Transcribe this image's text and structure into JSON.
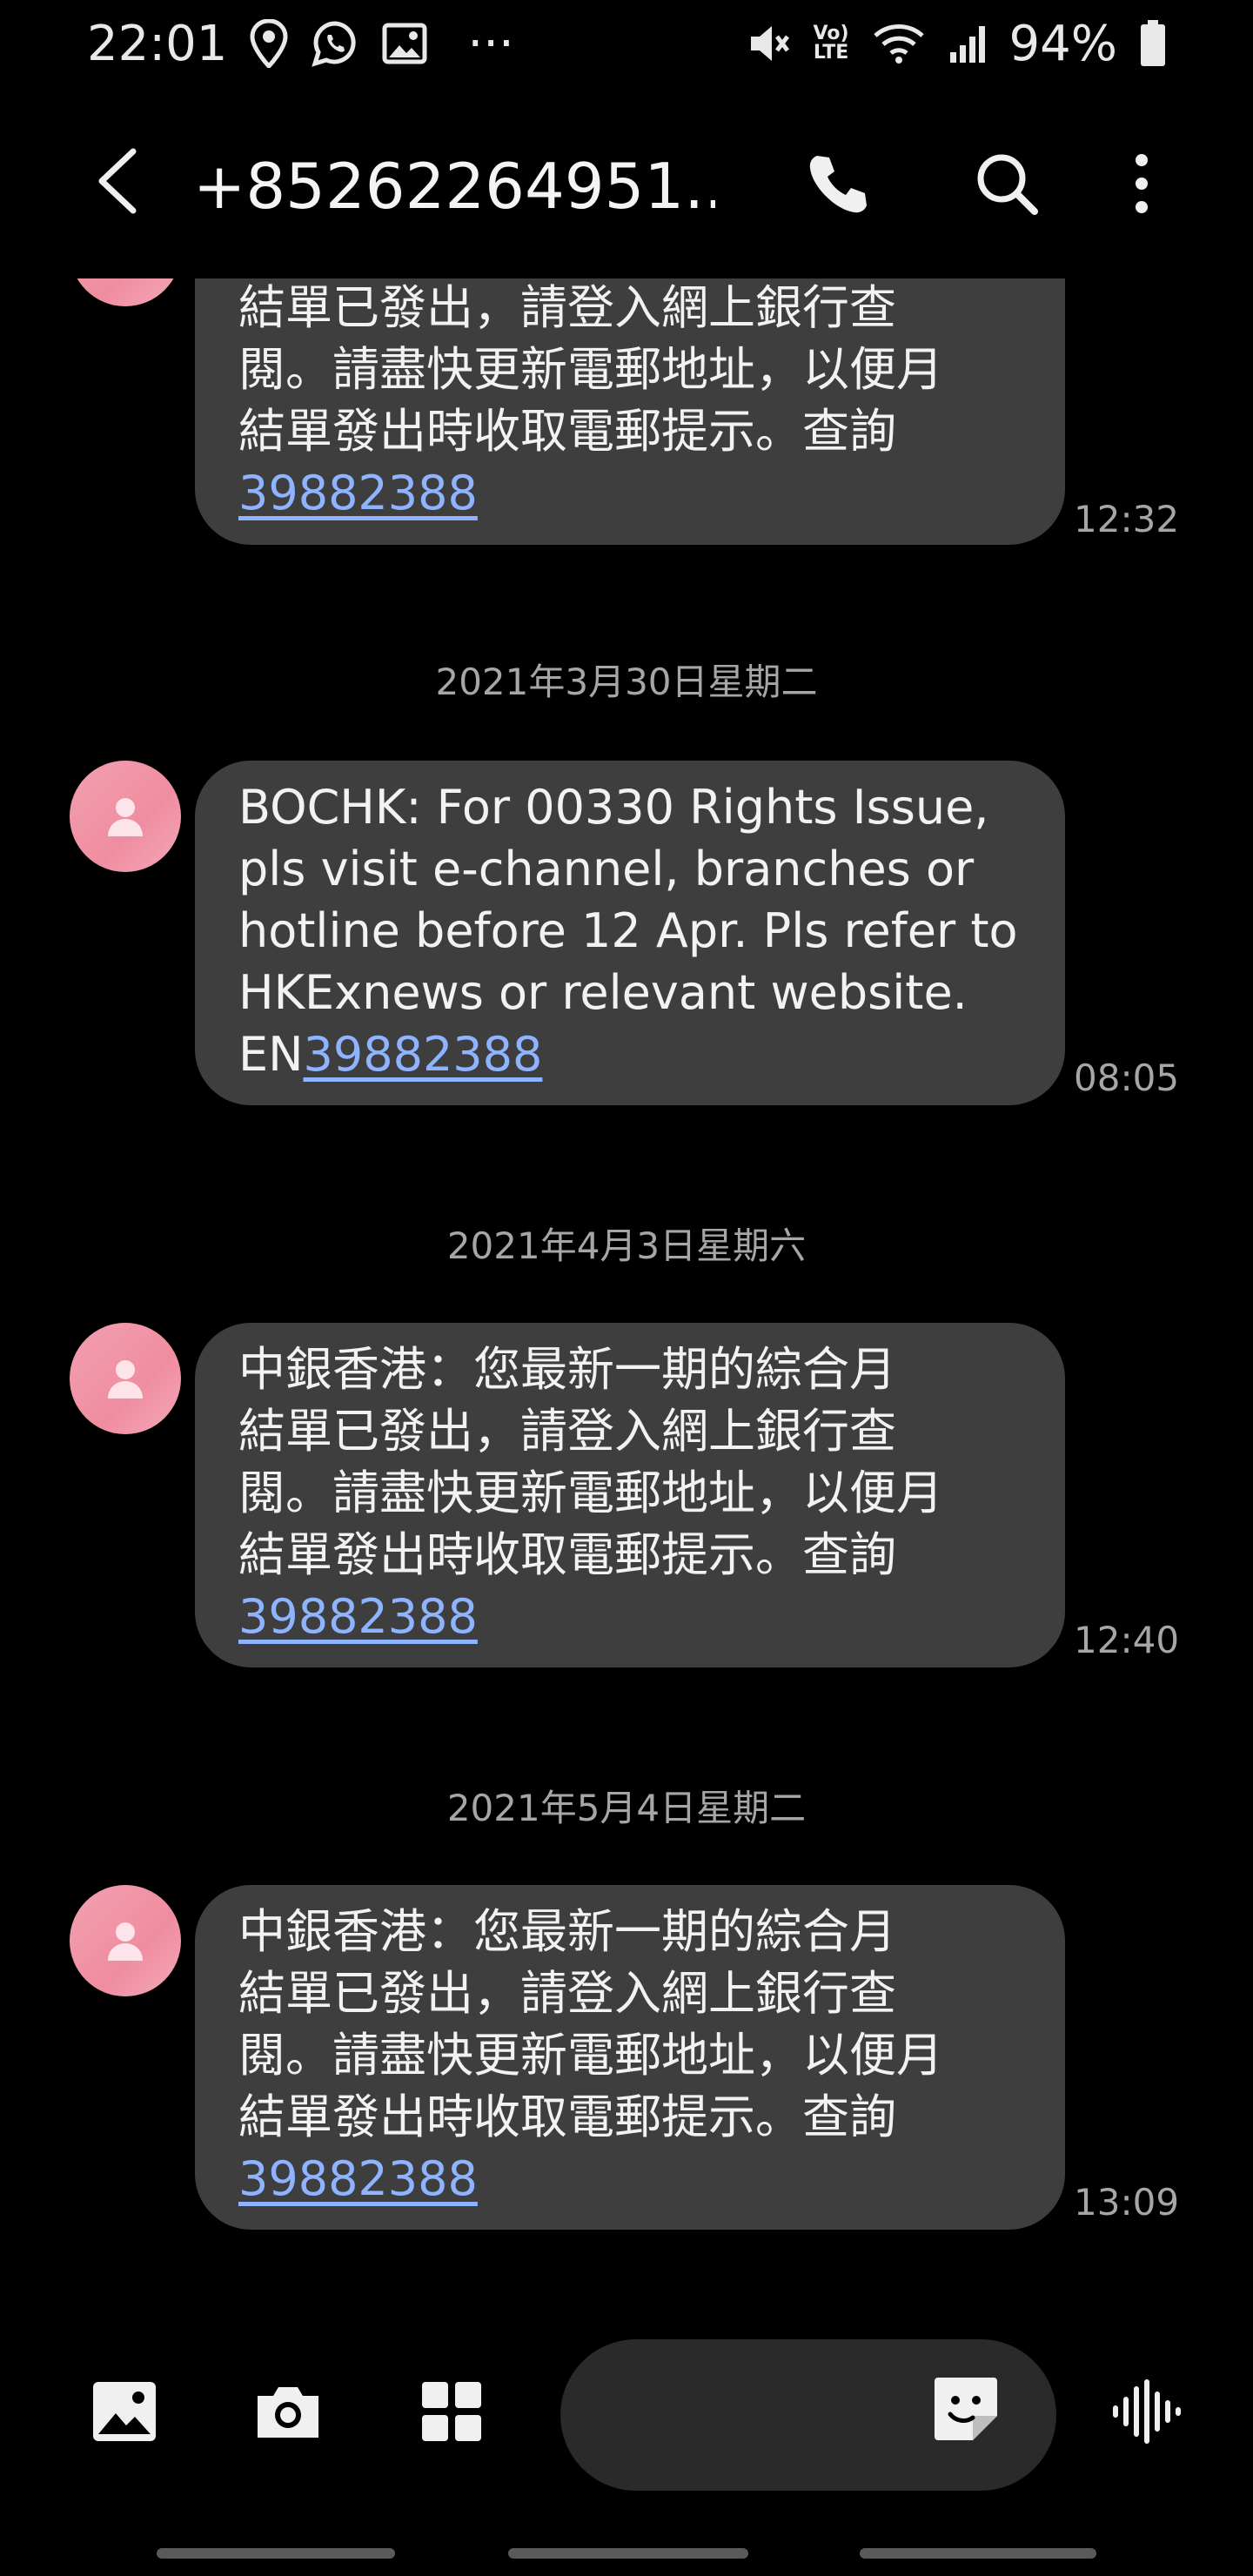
{
  "status_bar": {
    "time": "22:01",
    "more_indicator": "···",
    "battery": "94%",
    "lte_label_top": "Vo)",
    "lte_label_bottom": "LTE",
    "icons": [
      "location-pin-icon",
      "whatsapp-icon",
      "gallery-icon",
      "mute-icon",
      "volte-icon",
      "wifi-icon",
      "signal-icon",
      "battery-icon"
    ]
  },
  "app_bar": {
    "contact": "+85262264951...",
    "icons": [
      "back-arrow-icon",
      "phone-icon",
      "search-icon",
      "more-vert-icon"
    ]
  },
  "messages": [
    {
      "lines": [
        "結單已發出，請登入網上銀行查",
        "閱。請盡快更新電郵地址，以便月",
        "結單發出時收取電郵提示。查詢"
      ],
      "prefix": "",
      "link": "39882388",
      "time": "12:32"
    },
    {
      "date": "2021年3月30日星期二",
      "lines": [
        "BOCHK: For 00330 Rights Issue,",
        "pls visit e-channel, branches or",
        "hotline before 12 Apr. Pls refer to",
        "HKExnews or relevant website."
      ],
      "prefix": "EN",
      "link": "39882388",
      "time": "08:05"
    },
    {
      "date": "2021年4月3日星期六",
      "lines": [
        "中銀香港：您最新一期的綜合月",
        "結單已發出，請登入網上銀行查",
        "閱。請盡快更新電郵地址，以便月",
        "結單發出時收取電郵提示。查詢"
      ],
      "prefix": "",
      "link": "39882388",
      "time": "12:40"
    },
    {
      "date": "2021年5月4日星期二",
      "lines": [
        "中銀香港：您最新一期的綜合月",
        "結單已發出，請登入網上銀行查",
        "閱。請盡快更新電郵地址，以便月",
        "結單發出時收取電郵提示。查詢"
      ],
      "prefix": "",
      "link": "39882388",
      "time": "13:09"
    }
  ],
  "composer": {
    "icons": [
      "gallery-icon",
      "camera-icon",
      "apps-grid-icon",
      "sticker-icon",
      "voice-wave-icon"
    ]
  },
  "colors": {
    "background": "#000000",
    "bubble": "#3e3e3e",
    "link": "#8fb4ff",
    "avatar": "#ef8da0",
    "secondary_text": "#a6a6a6"
  }
}
